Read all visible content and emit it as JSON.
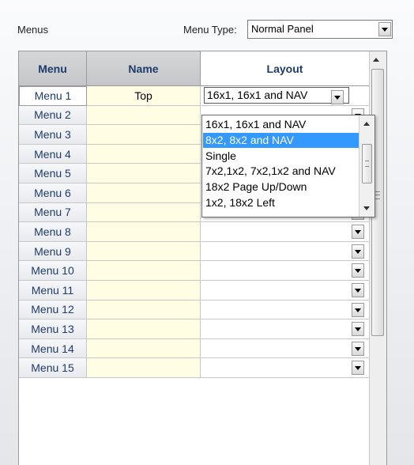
{
  "header": {
    "menus_label": "Menus",
    "menu_type_label": "Menu Type:",
    "menu_type_value": "Normal Panel"
  },
  "grid": {
    "columns": [
      "Menu",
      "Name",
      "Layout"
    ],
    "rows": [
      {
        "menu": "Menu 1",
        "name": "Top",
        "layout": "16x1, 16x1 and NAV"
      },
      {
        "menu": "Menu 2",
        "name": "",
        "layout": ""
      },
      {
        "menu": "Menu 3",
        "name": "",
        "layout": ""
      },
      {
        "menu": "Menu 4",
        "name": "",
        "layout": ""
      },
      {
        "menu": "Menu 5",
        "name": "",
        "layout": ""
      },
      {
        "menu": "Menu 6",
        "name": "",
        "layout": ""
      },
      {
        "menu": "Menu 7",
        "name": "",
        "layout": ""
      },
      {
        "menu": "Menu 8",
        "name": "",
        "layout": ""
      },
      {
        "menu": "Menu 9",
        "name": "",
        "layout": ""
      },
      {
        "menu": "Menu 10",
        "name": "",
        "layout": ""
      },
      {
        "menu": "Menu 11",
        "name": "",
        "layout": ""
      },
      {
        "menu": "Menu 12",
        "name": "",
        "layout": ""
      },
      {
        "menu": "Menu 13",
        "name": "",
        "layout": ""
      },
      {
        "menu": "Menu 14",
        "name": "",
        "layout": ""
      },
      {
        "menu": "Menu 15",
        "name": "",
        "layout": ""
      }
    ]
  },
  "layout_dropdown": {
    "options": [
      "16x1, 16x1 and NAV",
      "8x2, 8x2 and NAV",
      "Single",
      "7x2,1x2, 7x2,1x2 and NAV",
      "18x2 Page Up/Down",
      "1x2, 18x2 Left"
    ],
    "highlighted": "8x2, 8x2 and NAV"
  },
  "icons": {
    "dropdown": "chevron-down-icon",
    "scroll_up": "scroll-up-arrow-icon",
    "scroll_down": "scroll-down-arrow-icon"
  },
  "colors": {
    "highlight": "#3399ff",
    "name_cell_bg": "#fffee5",
    "header_text": "#1f3b6b"
  }
}
